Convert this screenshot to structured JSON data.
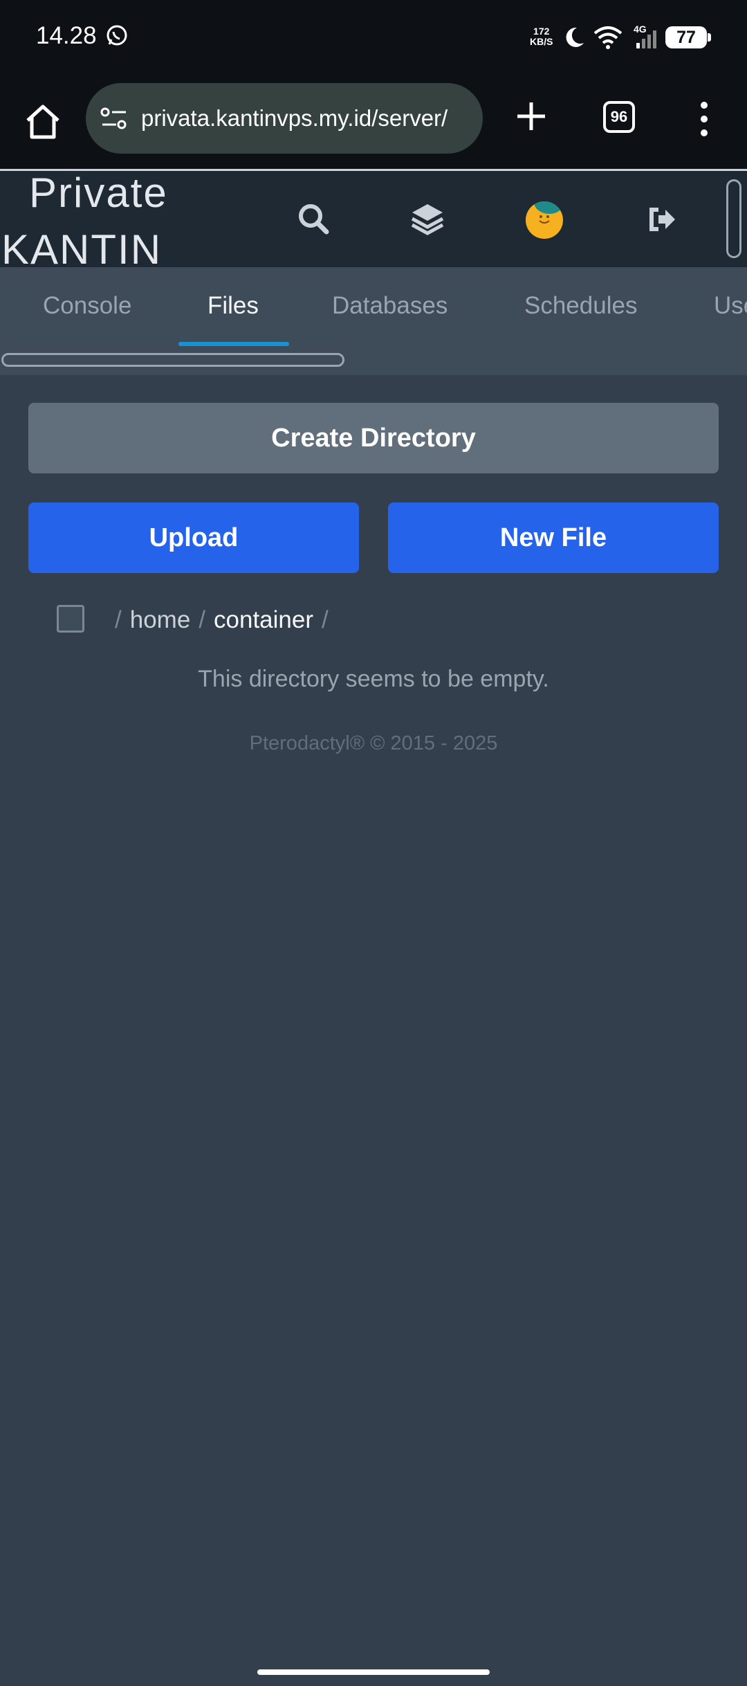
{
  "status_bar": {
    "time": "14.28",
    "net_speed_value": "172",
    "net_speed_unit": "KB/S",
    "network_type": "4G",
    "battery": "77"
  },
  "browser": {
    "url": "privata.kantinvps.my.id/server/",
    "tab_count": "96"
  },
  "header": {
    "brand_line1": "Private",
    "brand_line2": "KANTIN",
    "icons": [
      "search-icon",
      "layers-icon",
      "avatar",
      "logout-icon"
    ]
  },
  "nav": {
    "tabs": [
      {
        "label": "Console"
      },
      {
        "label": "Files"
      },
      {
        "label": "Databases"
      },
      {
        "label": "Schedules"
      },
      {
        "label": "Use"
      }
    ],
    "active": "Files"
  },
  "actions": {
    "create_directory": "Create Directory",
    "upload": "Upload",
    "new_file": "New File"
  },
  "breadcrumb": {
    "sep": "/",
    "home": "home",
    "current": "container"
  },
  "content": {
    "empty_message": "This directory seems to be empty."
  },
  "footer": {
    "text": "Pterodactyl® © 2015 - 2025"
  },
  "colors": {
    "primary_button": "#2563eb",
    "secondary_button": "#616e7c",
    "background": "#333f4c",
    "tab_active_underline": "#1992d4"
  }
}
